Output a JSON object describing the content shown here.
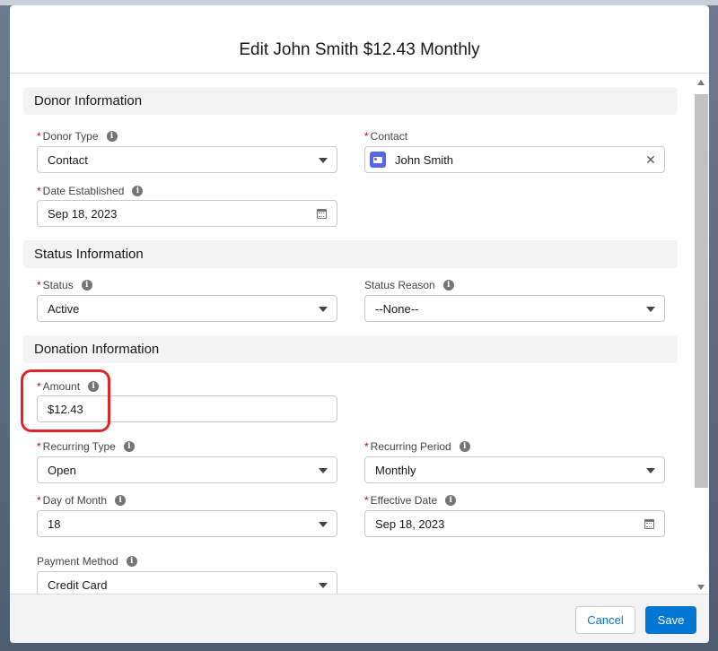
{
  "modal": {
    "title": "Edit John Smith $12.43 Monthly"
  },
  "sections": {
    "donor": "Donor Information",
    "status": "Status Information",
    "donation": "Donation Information"
  },
  "fields": {
    "donor_type": {
      "label": "Donor Type",
      "value": "Contact"
    },
    "contact": {
      "label": "Contact",
      "value": "John Smith"
    },
    "date_established": {
      "label": "Date Established",
      "value": "Sep 18, 2023"
    },
    "status": {
      "label": "Status",
      "value": "Active"
    },
    "status_reason": {
      "label": "Status Reason",
      "value": "--None--"
    },
    "amount": {
      "label": "Amount",
      "value": "$12.43"
    },
    "recurring_type": {
      "label": "Recurring Type",
      "value": "Open"
    },
    "recurring_period": {
      "label": "Recurring Period",
      "value": "Monthly"
    },
    "day_of_month": {
      "label": "Day of Month",
      "value": "18"
    },
    "effective_date": {
      "label": "Effective Date",
      "value": "Sep 18, 2023"
    },
    "payment_method": {
      "label": "Payment Method",
      "value": "Credit Card"
    }
  },
  "required_marker": "*",
  "info_glyph": "i",
  "clear_glyph": "✕",
  "footer": {
    "cancel": "Cancel",
    "save": "Save"
  },
  "colors": {
    "brand": "#0176d3",
    "required": "#ba0517",
    "highlight": "#e32424",
    "contact_icon": "#5867e8"
  }
}
